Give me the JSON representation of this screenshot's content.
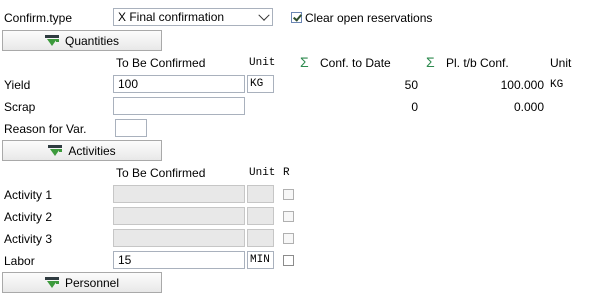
{
  "header": {
    "confirm_type_label": "Confirm.type",
    "confirm_type_value": "X Final confirmation",
    "clear_reservations_label": "Clear open reservations",
    "clear_reservations_checked": true
  },
  "quantities": {
    "button_label": "Quantities",
    "col_to_be_confirmed": "To Be Confirmed",
    "col_unit": "Unit",
    "sigma_symbol": "Σ",
    "col_conf_to_date": "Conf. to Date",
    "col_plan_tb_conf": "Pl. t/b Conf.",
    "col_unit2": "Unit",
    "rows": [
      {
        "label": "Yield",
        "to_be_confirmed": "100",
        "unit": "KG",
        "conf_to_date": "50",
        "plan_tb_conf": "100.000",
        "unit2": "KG"
      },
      {
        "label": "Scrap",
        "to_be_confirmed": "",
        "unit": "",
        "conf_to_date": "0",
        "plan_tb_conf": "0.000",
        "unit2": ""
      }
    ],
    "reason_for_var_label": "Reason for Var.",
    "reason_for_var_value": ""
  },
  "activities": {
    "button_label": "Activities",
    "col_to_be_confirmed": "To Be Confirmed",
    "col_unit": "Unit",
    "col_r": "R",
    "rows": [
      {
        "label": "Activity 1",
        "value": "",
        "unit": "",
        "enabled": false
      },
      {
        "label": "Activity 2",
        "value": "",
        "unit": "",
        "enabled": false
      },
      {
        "label": "Activity 3",
        "value": "",
        "unit": "",
        "enabled": false
      },
      {
        "label": "Labor",
        "value": "15",
        "unit": "MIN",
        "enabled": true
      }
    ]
  },
  "personnel": {
    "button_label": "Personnel"
  },
  "colors": {
    "sigma": "#2d8a4e",
    "section_icon_green": "#3c9a3c",
    "disabled_field": "#e8e8e8",
    "field_border": "#a9b1bd"
  },
  "icons": {
    "section_button_icon": "expand-section-icon",
    "sigma_icon": "sigma-total-icon"
  }
}
